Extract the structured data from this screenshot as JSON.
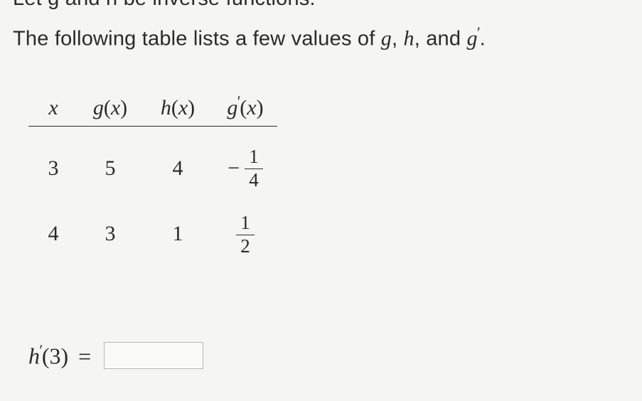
{
  "cutoff_text": "Let g and h be inverse functions.",
  "intro": {
    "prefix": "The following table lists a few values of ",
    "f1": "g",
    "sep1": ", ",
    "f2": "h",
    "sep2": ", and ",
    "f3": "g",
    "f3_prime": "′",
    "suffix": "."
  },
  "table": {
    "headers": {
      "x": "x",
      "gx_fn": "g",
      "gx_arg": "x",
      "hx_fn": "h",
      "hx_arg": "x",
      "gpx_fn": "g",
      "gpx_prime": "′",
      "gpx_arg": "x"
    },
    "rows": [
      {
        "x": "3",
        "gx": "5",
        "hx": "4",
        "gpx_sign": "−",
        "gpx_num": "1",
        "gpx_den": "4"
      },
      {
        "x": "4",
        "gx": "3",
        "hx": "1",
        "gpx_sign": "",
        "gpx_num": "1",
        "gpx_den": "2"
      }
    ]
  },
  "answer": {
    "fn": "h",
    "prime": "′",
    "arg": "3",
    "equals": "=",
    "value": ""
  },
  "chart_data": {
    "type": "table",
    "title": "Values of g, h, and g'",
    "columns": [
      "x",
      "g(x)",
      "h(x)",
      "g'(x)"
    ],
    "rows": [
      {
        "x": 3,
        "g(x)": 5,
        "h(x)": 4,
        "g'(x)": -0.25
      },
      {
        "x": 4,
        "g(x)": 3,
        "h(x)": 1,
        "g'(x)": 0.5
      }
    ],
    "question": "h'(3) = ?"
  }
}
